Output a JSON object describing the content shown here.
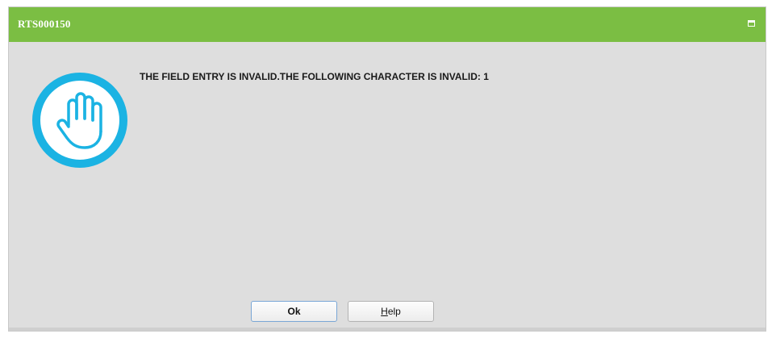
{
  "dialog": {
    "title": "RTS000150",
    "message": "THE FIELD ENTRY IS INVALID.THE FOLLOWING CHARACTER IS INVALID: 1",
    "icon": "stop-hand-icon",
    "colors": {
      "titlebar": "#7bbe43",
      "icon": "#1bb3e3",
      "background": "#dedede"
    }
  },
  "buttons": {
    "ok_label": "Ok",
    "help_mnemonic": "H",
    "help_rest": "elp"
  }
}
